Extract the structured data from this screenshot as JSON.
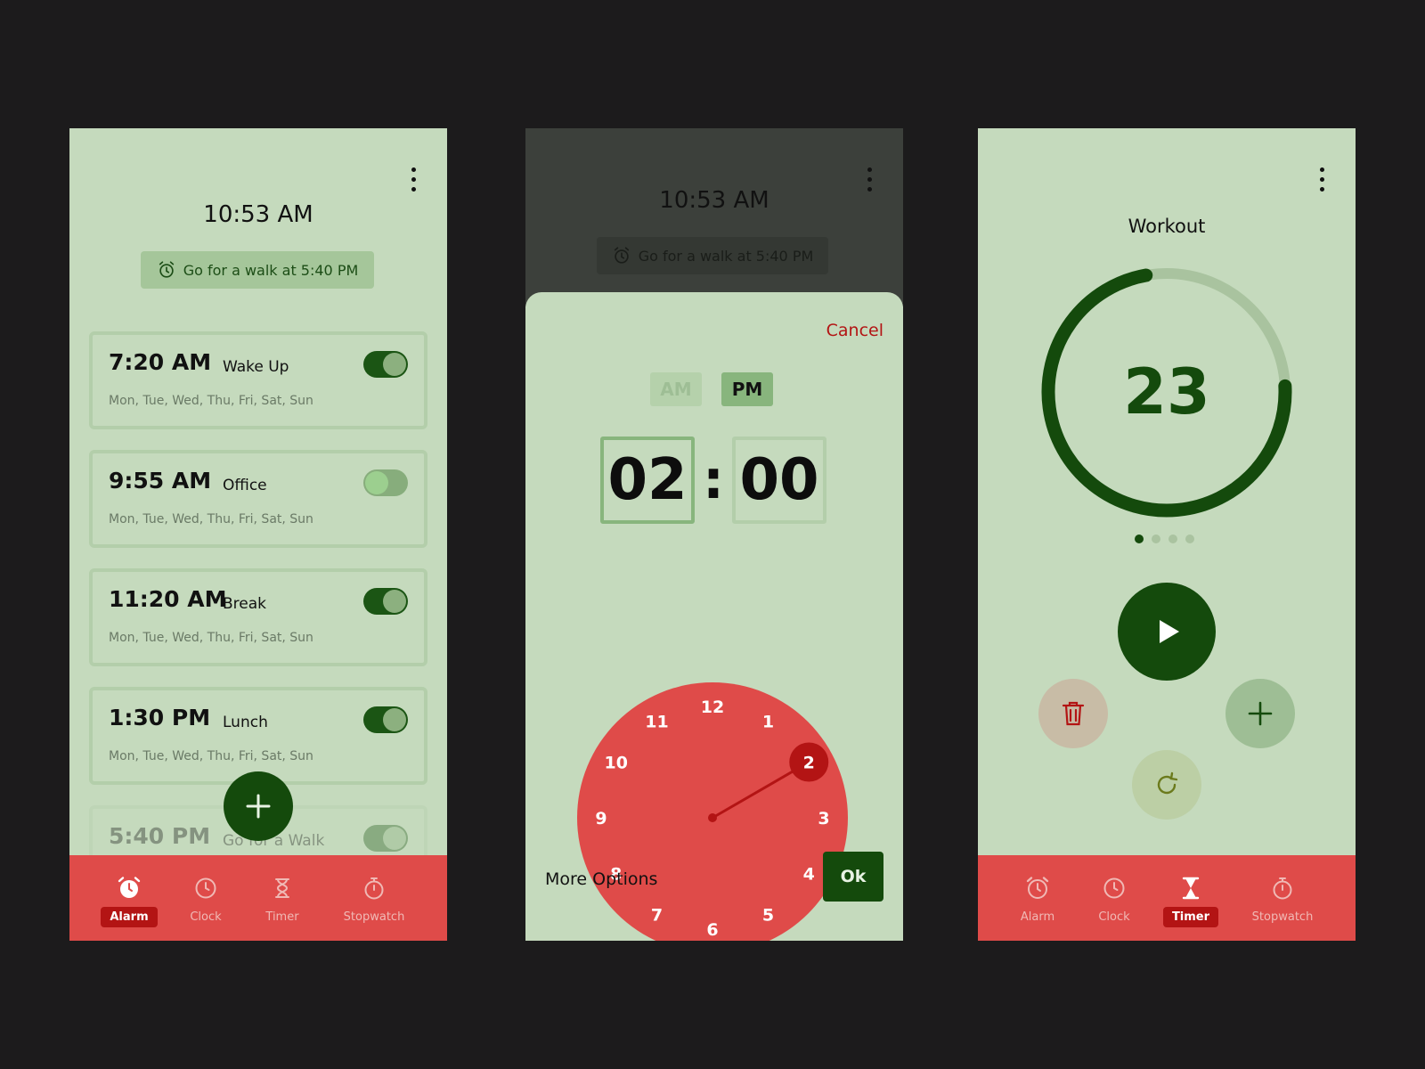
{
  "alarm_screen": {
    "current_time": "10:53 AM",
    "next_alarm": "Go for a walk at  5:40 PM",
    "alarms": [
      {
        "time": "7:20 AM",
        "label": "Wake Up",
        "days": "Mon, Tue, Wed, Thu, Fri, Sat, Sun",
        "enabled": true
      },
      {
        "time": "9:55 AM",
        "label": "Office",
        "days": "Mon, Tue, Wed, Thu, Fri, Sat, Sun",
        "enabled": false
      },
      {
        "time": "11:20 AM",
        "label": "Break",
        "days": "Mon, Tue, Wed, Thu, Fri, Sat, Sun",
        "enabled": true
      },
      {
        "time": "1:30 PM",
        "label": "Lunch",
        "days": "Mon, Tue, Wed, Thu, Fri, Sat, Sun",
        "enabled": true
      },
      {
        "time": "5:40 PM",
        "label": "Go for a Walk",
        "enabled": true
      }
    ]
  },
  "picker_screen": {
    "current_time": "10:53 AM",
    "next_alarm": "Go for a walk at  5:40 PM",
    "cancel": "Cancel",
    "am": "AM",
    "pm": "PM",
    "selected_period": "PM",
    "hour": "02",
    "separator": ":",
    "minute": "00",
    "dial_numbers": [
      "12",
      "1",
      "2",
      "3",
      "4",
      "5",
      "6",
      "7",
      "8",
      "9",
      "10",
      "11"
    ],
    "selected_hour": 2,
    "more_options": "More Options",
    "ok": "Ok"
  },
  "timer_screen": {
    "name": "Workout",
    "remaining": "23",
    "progress_fraction": 0.27,
    "page_count": 4,
    "active_page": 1
  },
  "nav": {
    "items": [
      {
        "label": "Alarm",
        "icon": "alarm-clock-icon"
      },
      {
        "label": "Clock",
        "icon": "clock-icon"
      },
      {
        "label": "Timer",
        "icon": "hourglass-icon"
      },
      {
        "label": "Stopwatch",
        "icon": "stopwatch-icon"
      }
    ]
  },
  "colors": {
    "background": "#c5dabd",
    "accent_dark_green": "#144a0c",
    "accent_red": "#df4b49",
    "selected_red": "#b31414"
  }
}
